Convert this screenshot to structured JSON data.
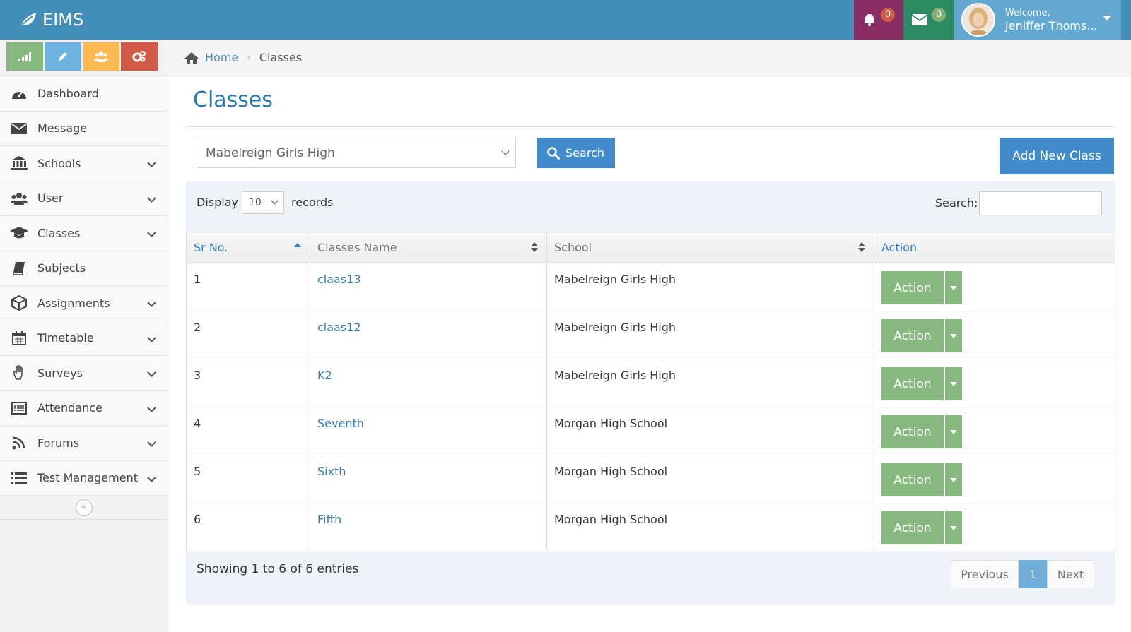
{
  "brand": {
    "name": "EIMS"
  },
  "navbar": {
    "notifications_count": "0",
    "messages_count": "0",
    "welcome": "Welcome,",
    "user_name": "Jeniffer Thoms..."
  },
  "sidebar": {
    "items": [
      {
        "label": "Dashboard",
        "icon": "dashboard-icon",
        "expandable": false
      },
      {
        "label": "Message",
        "icon": "envelope-icon",
        "expandable": false
      },
      {
        "label": "Schools",
        "icon": "bank-icon",
        "expandable": true
      },
      {
        "label": "User",
        "icon": "users-icon",
        "expandable": true
      },
      {
        "label": "Classes",
        "icon": "graduation-cap-icon",
        "expandable": true
      },
      {
        "label": "Subjects",
        "icon": "book-icon",
        "expandable": false
      },
      {
        "label": "Assignments",
        "icon": "cube-icon",
        "expandable": true
      },
      {
        "label": "Timetable",
        "icon": "calendar-icon",
        "expandable": true
      },
      {
        "label": "Surveys",
        "icon": "hand-icon",
        "expandable": true
      },
      {
        "label": "Attendance",
        "icon": "list-alt-icon",
        "expandable": true
      },
      {
        "label": "Forums",
        "icon": "feed-icon",
        "expandable": true
      },
      {
        "label": "Test Management",
        "icon": "list-icon",
        "expandable": true
      }
    ],
    "collapse_glyph": "«"
  },
  "breadcrumb": {
    "home": "Home",
    "current": "Classes"
  },
  "page": {
    "title": "Classes",
    "school_select_value": "Mabelreign Girls High",
    "search_button": "Search",
    "add_button": "Add New Class"
  },
  "table": {
    "display_label": "Display",
    "page_length": "10",
    "records_label": "records",
    "filter_label": "Search:",
    "columns": [
      "Sr No.",
      "Classes Name",
      "School",
      "Action"
    ],
    "rows": [
      {
        "sr": "1",
        "name": "claas13",
        "school": "Mabelreign Girls High",
        "action": "Action"
      },
      {
        "sr": "2",
        "name": "claas12",
        "school": "Mabelreign Girls High",
        "action": "Action"
      },
      {
        "sr": "3",
        "name": "K2",
        "school": "Mabelreign Girls High",
        "action": "Action"
      },
      {
        "sr": "4",
        "name": "Seventh",
        "school": "Morgan High School",
        "action": "Action"
      },
      {
        "sr": "5",
        "name": "Sixth",
        "school": "Morgan High School",
        "action": "Action"
      },
      {
        "sr": "6",
        "name": "Fifth",
        "school": "Morgan High School",
        "action": "Action"
      }
    ],
    "info": "Showing 1 to 6 of 6 entries",
    "pagination": {
      "previous": "Previous",
      "current": "1",
      "next": "Next"
    }
  },
  "colors": {
    "navbar": "#438eb9",
    "notifications_bg": "#892e65",
    "messages_bg": "#2e8965",
    "user_bg": "#62a8d1",
    "primary_button": "#428bca",
    "action_button": "#87b87f",
    "title": "#2679b5"
  }
}
